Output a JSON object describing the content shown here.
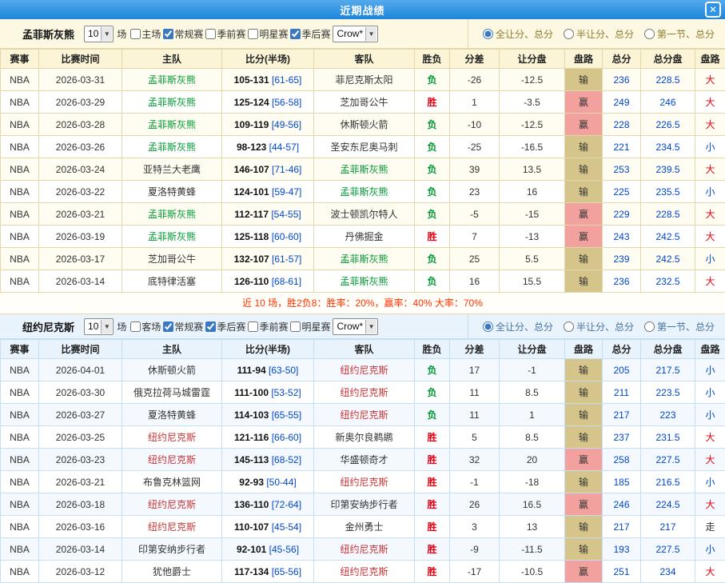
{
  "title_bar": {
    "title": "近期战绩",
    "close_glyph": "✕"
  },
  "columns": [
    "赛事",
    "比赛时间",
    "主队",
    "比分(半场)",
    "客队",
    "胜负",
    "分差",
    "让分盘",
    "盘路",
    "总分",
    "总分盘",
    "盘路"
  ],
  "colors": {
    "win": "#e60012",
    "loss": "#009933",
    "blue_value": "#0046cc",
    "handicap_win_bg": "#f2a19e",
    "handicap_loss_bg": "#d5c58b",
    "big": "#e60012",
    "small": "#0046cc",
    "push": "#333333",
    "summary": "#ff3300"
  },
  "sections": [
    {
      "team": "孟菲斯灰熊",
      "focus_color": "#009933",
      "games_count": "10",
      "games_suffix": "场",
      "odds_company": "Crow*",
      "checkboxes": [
        {
          "label": "主场",
          "checked": false
        },
        {
          "label": "常规赛",
          "checked": true
        },
        {
          "label": "季前赛",
          "checked": false
        },
        {
          "label": "明星赛",
          "checked": false
        },
        {
          "label": "季后赛",
          "checked": true
        }
      ],
      "radios": [
        {
          "label": "全让分、总分",
          "selected": true
        },
        {
          "label": "半让分、总分",
          "selected": false
        },
        {
          "label": "第一节、总分",
          "selected": false
        }
      ],
      "rows": [
        {
          "league": "NBA",
          "date": "2026-03-31",
          "home": "孟菲斯灰熊",
          "score": "105-131",
          "half": "[61-65]",
          "away": "菲尼克斯太阳",
          "result": "负",
          "diff": "-26",
          "handicap": "-12.5",
          "handicap_result": "输",
          "total": "236",
          "total_line": "228.5",
          "ou": "大"
        },
        {
          "league": "NBA",
          "date": "2026-03-29",
          "home": "孟菲斯灰熊",
          "score": "125-124",
          "half": "[56-58]",
          "away": "芝加哥公牛",
          "result": "胜",
          "diff": "1",
          "handicap": "-3.5",
          "handicap_result": "赢",
          "total": "249",
          "total_line": "246",
          "ou": "大"
        },
        {
          "league": "NBA",
          "date": "2026-03-28",
          "home": "孟菲斯灰熊",
          "score": "109-119",
          "half": "[49-56]",
          "away": "休斯顿火箭",
          "result": "负",
          "diff": "-10",
          "handicap": "-12.5",
          "handicap_result": "赢",
          "total": "228",
          "total_line": "226.5",
          "ou": "大"
        },
        {
          "league": "NBA",
          "date": "2026-03-26",
          "home": "孟菲斯灰熊",
          "score": "98-123",
          "half": "[44-57]",
          "away": "圣安东尼奥马刺",
          "result": "负",
          "diff": "-25",
          "handicap": "-16.5",
          "handicap_result": "输",
          "total": "221",
          "total_line": "234.5",
          "ou": "小"
        },
        {
          "league": "NBA",
          "date": "2026-03-24",
          "home": "亚特兰大老鹰",
          "score": "146-107",
          "half": "[71-46]",
          "away": "孟菲斯灰熊",
          "result": "负",
          "diff": "39",
          "handicap": "13.5",
          "handicap_result": "输",
          "total": "253",
          "total_line": "239.5",
          "ou": "大"
        },
        {
          "league": "NBA",
          "date": "2026-03-22",
          "home": "夏洛特黄蜂",
          "score": "124-101",
          "half": "[59-47]",
          "away": "孟菲斯灰熊",
          "result": "负",
          "diff": "23",
          "handicap": "16",
          "handicap_result": "输",
          "total": "225",
          "total_line": "235.5",
          "ou": "小"
        },
        {
          "league": "NBA",
          "date": "2026-03-21",
          "home": "孟菲斯灰熊",
          "score": "112-117",
          "half": "[54-55]",
          "away": "波士顿凯尔特人",
          "result": "负",
          "diff": "-5",
          "handicap": "-15",
          "handicap_result": "赢",
          "total": "229",
          "total_line": "228.5",
          "ou": "大"
        },
        {
          "league": "NBA",
          "date": "2026-03-19",
          "home": "孟菲斯灰熊",
          "score": "125-118",
          "half": "[60-60]",
          "away": "丹佛掘金",
          "result": "胜",
          "diff": "7",
          "handicap": "-13",
          "handicap_result": "赢",
          "total": "243",
          "total_line": "242.5",
          "ou": "大"
        },
        {
          "league": "NBA",
          "date": "2026-03-17",
          "home": "芝加哥公牛",
          "score": "132-107",
          "half": "[61-57]",
          "away": "孟菲斯灰熊",
          "result": "负",
          "diff": "25",
          "handicap": "5.5",
          "handicap_result": "输",
          "total": "239",
          "total_line": "242.5",
          "ou": "小"
        },
        {
          "league": "NBA",
          "date": "2026-03-14",
          "home": "底特律活塞",
          "score": "126-110",
          "half": "[68-61]",
          "away": "孟菲斯灰熊",
          "result": "负",
          "diff": "16",
          "handicap": "15.5",
          "handicap_result": "输",
          "total": "236",
          "total_line": "232.5",
          "ou": "大"
        }
      ],
      "summary": "近 10 场，胜2负8：胜率：20%，赢率：40% 大率：70%"
    },
    {
      "team": "纽约尼克斯",
      "focus_color": "#cc3333",
      "games_count": "10",
      "games_suffix": "场",
      "odds_company": "Crow*",
      "checkboxes": [
        {
          "label": "客场",
          "checked": false
        },
        {
          "label": "常规赛",
          "checked": true
        },
        {
          "label": "季后赛",
          "checked": true
        },
        {
          "label": "季前赛",
          "checked": false
        },
        {
          "label": "明星赛",
          "checked": false
        }
      ],
      "radios": [
        {
          "label": "全让分、总分",
          "selected": true
        },
        {
          "label": "半让分、总分",
          "selected": false
        },
        {
          "label": "第一节、总分",
          "selected": false
        }
      ],
      "rows": [
        {
          "league": "NBA",
          "date": "2026-04-01",
          "home": "休斯顿火箭",
          "score": "111-94",
          "half": "[63-50]",
          "away": "纽约尼克斯",
          "result": "负",
          "diff": "17",
          "handicap": "-1",
          "handicap_result": "输",
          "total": "205",
          "total_line": "217.5",
          "ou": "小"
        },
        {
          "league": "NBA",
          "date": "2026-03-30",
          "home": "俄克拉荷马城雷霆",
          "score": "111-100",
          "half": "[53-52]",
          "away": "纽约尼克斯",
          "result": "负",
          "diff": "11",
          "handicap": "8.5",
          "handicap_result": "输",
          "total": "211",
          "total_line": "223.5",
          "ou": "小"
        },
        {
          "league": "NBA",
          "date": "2026-03-27",
          "home": "夏洛特黄蜂",
          "score": "114-103",
          "half": "[65-55]",
          "away": "纽约尼克斯",
          "result": "负",
          "diff": "11",
          "handicap": "1",
          "handicap_result": "输",
          "total": "217",
          "total_line": "223",
          "ou": "小"
        },
        {
          "league": "NBA",
          "date": "2026-03-25",
          "home": "纽约尼克斯",
          "score": "121-116",
          "half": "[66-60]",
          "away": "新奥尔良鹈鹕",
          "result": "胜",
          "diff": "5",
          "handicap": "8.5",
          "handicap_result": "输",
          "total": "237",
          "total_line": "231.5",
          "ou": "大"
        },
        {
          "league": "NBA",
          "date": "2026-03-23",
          "home": "纽约尼克斯",
          "score": "145-113",
          "half": "[68-52]",
          "away": "华盛顿奇才",
          "result": "胜",
          "diff": "32",
          "handicap": "20",
          "handicap_result": "赢",
          "total": "258",
          "total_line": "227.5",
          "ou": "大"
        },
        {
          "league": "NBA",
          "date": "2026-03-21",
          "home": "布鲁克林篮网",
          "score": "92-93",
          "half": "[50-44]",
          "away": "纽约尼克斯",
          "result": "胜",
          "diff": "-1",
          "handicap": "-18",
          "handicap_result": "输",
          "total": "185",
          "total_line": "216.5",
          "ou": "小"
        },
        {
          "league": "NBA",
          "date": "2026-03-18",
          "home": "纽约尼克斯",
          "score": "136-110",
          "half": "[72-64]",
          "away": "印第安纳步行者",
          "result": "胜",
          "diff": "26",
          "handicap": "16.5",
          "handicap_result": "赢",
          "total": "246",
          "total_line": "224.5",
          "ou": "大"
        },
        {
          "league": "NBA",
          "date": "2026-03-16",
          "home": "纽约尼克斯",
          "score": "110-107",
          "half": "[45-54]",
          "away": "金州勇士",
          "result": "胜",
          "diff": "3",
          "handicap": "13",
          "handicap_result": "输",
          "total": "217",
          "total_line": "217",
          "ou": "走"
        },
        {
          "league": "NBA",
          "date": "2026-03-14",
          "home": "印第安纳步行者",
          "score": "92-101",
          "half": "[45-56]",
          "away": "纽约尼克斯",
          "result": "胜",
          "diff": "-9",
          "handicap": "-11.5",
          "handicap_result": "输",
          "total": "193",
          "total_line": "227.5",
          "ou": "小"
        },
        {
          "league": "NBA",
          "date": "2026-03-12",
          "home": "犹他爵士",
          "score": "117-134",
          "half": "[65-56]",
          "away": "纽约尼克斯",
          "result": "胜",
          "diff": "-17",
          "handicap": "-10.5",
          "handicap_result": "赢",
          "total": "251",
          "total_line": "234",
          "ou": "大"
        }
      ]
    }
  ]
}
